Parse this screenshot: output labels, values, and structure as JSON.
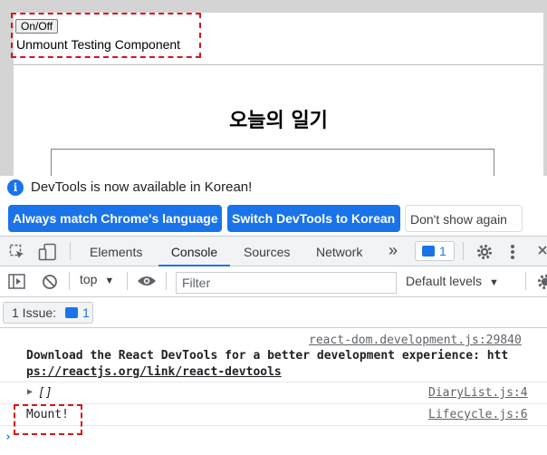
{
  "page": {
    "toggle_button_label": "On/Off",
    "unmount_text": "Unmount Testing Component",
    "diary_title": "오늘의 일기"
  },
  "devtools": {
    "info_bar": {
      "message": "DevTools is now available in Korean!",
      "match_button": "Always match Chrome's language",
      "switch_button": "Switch DevTools to Korean",
      "dismiss_button": "Don't show again"
    },
    "tabs": [
      "Elements",
      "Console",
      "Sources",
      "Network"
    ],
    "active_tab": "Console",
    "more_tabs_glyph": "»",
    "issues_count": "1",
    "console_toolbar": {
      "context": "top",
      "filter_placeholder": "Filter",
      "levels": "Default levels"
    },
    "issues_summary": {
      "label": "1 Issue:",
      "count": "1"
    },
    "logs": [
      {
        "source": "react-dom.development.js:29840",
        "line1": "Download the React DevTools for a better development experience: htt",
        "line2": "ps://reactjs.org/link/react-devtools"
      },
      {
        "source": "DiaryList.js:4",
        "value": "[]"
      },
      {
        "source": "Lifecycle.js:6",
        "value": "Mount!"
      }
    ]
  },
  "colors": {
    "accent": "#1a73e8",
    "highlight": "#d9141a"
  }
}
